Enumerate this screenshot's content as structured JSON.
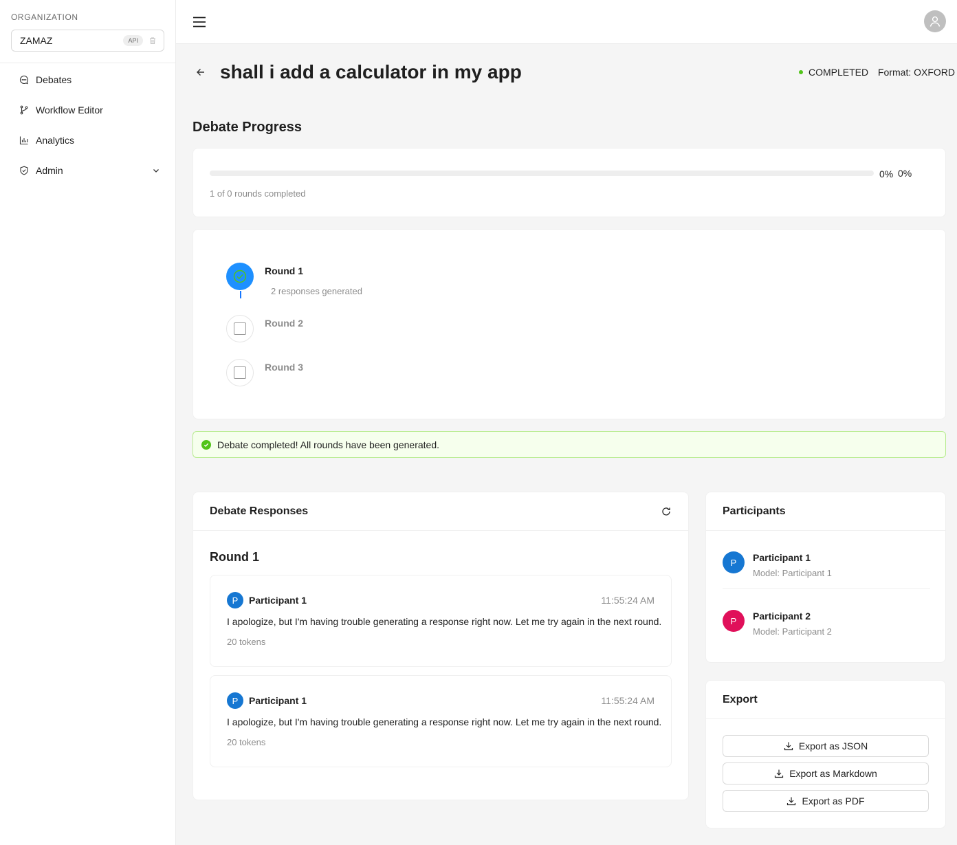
{
  "sidebar": {
    "org_label": "ORGANIZATION",
    "org_name": "ZAMAZ",
    "api_badge": "API",
    "items": [
      {
        "label": "Debates",
        "icon": "chat-icon"
      },
      {
        "label": "Workflow Editor",
        "icon": "branch-icon"
      },
      {
        "label": "Analytics",
        "icon": "bar-chart-icon"
      },
      {
        "label": "Admin",
        "icon": "shield-icon"
      }
    ]
  },
  "header": {
    "title": "shall i add a calculator in my app",
    "status": "COMPLETED",
    "format": "Format: OXFORD"
  },
  "progress": {
    "section_title": "Debate Progress",
    "percent": 0,
    "percent_label_1": "0%",
    "percent_label_2": "0%",
    "rounds_text": "1 of 0 rounds completed"
  },
  "steps": [
    {
      "title": "Round 1",
      "description": "2 responses generated",
      "state": "done"
    },
    {
      "title": "Round 2",
      "description": "",
      "state": "wait"
    },
    {
      "title": "Round 3",
      "description": "",
      "state": "wait"
    }
  ],
  "alert": {
    "text": "Debate completed! All rounds have been generated."
  },
  "responses": {
    "title": "Debate Responses",
    "round_heading": "Round 1",
    "items": [
      {
        "avatar": "P",
        "name": "Participant 1",
        "time": "11:55:24 AM",
        "text": "I apologize, but I'm having trouble generating a response right now. Let me try again in the next round.",
        "tokens": "20 tokens"
      },
      {
        "avatar": "P",
        "name": "Participant 1",
        "time": "11:55:24 AM",
        "text": "I apologize, but I'm having trouble generating a response right now. Let me try again in the next round.",
        "tokens": "20 tokens"
      }
    ]
  },
  "participants": {
    "title": "Participants",
    "items": [
      {
        "avatar": "P",
        "name": "Participant 1",
        "model": "Model: Participant 1",
        "color": "#1677d2"
      },
      {
        "avatar": "P",
        "name": "Participant 2",
        "model": "Model: Participant 2",
        "color": "#e0105a"
      }
    ]
  },
  "export": {
    "title": "Export",
    "buttons": [
      "Export as JSON",
      "Export as Markdown",
      "Export as PDF"
    ]
  },
  "colors": {
    "primary": "#1677ff",
    "success": "#52c41a"
  }
}
